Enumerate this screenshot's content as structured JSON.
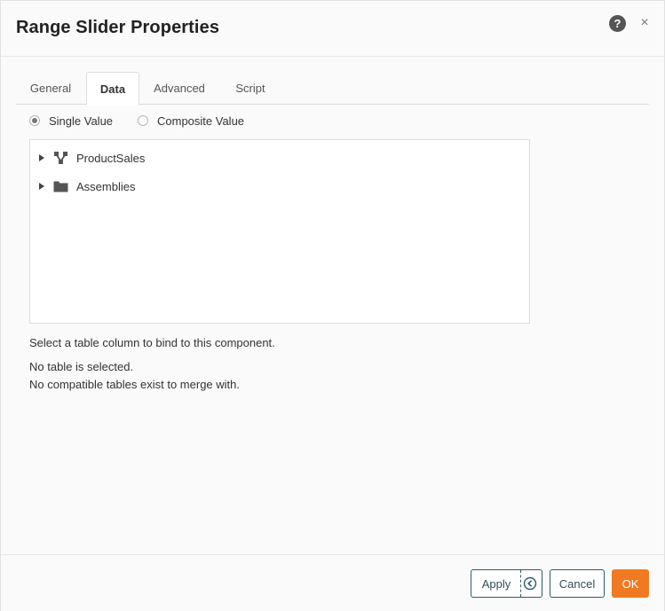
{
  "dialog": {
    "title": "Range Slider Properties",
    "help_icon": "help-icon",
    "help_glyph": "?",
    "close_icon": "close-icon",
    "close_glyph": "×"
  },
  "tabs": [
    {
      "label": "General",
      "active": false
    },
    {
      "label": "Data",
      "active": true
    },
    {
      "label": "Advanced",
      "active": false
    },
    {
      "label": "Script",
      "active": false
    }
  ],
  "value_mode": {
    "options": [
      {
        "label": "Single Value",
        "checked": true
      },
      {
        "label": "Composite Value",
        "checked": false
      }
    ]
  },
  "tree": {
    "items": [
      {
        "label": "ProductSales",
        "icon": "data-model-icon"
      },
      {
        "label": "Assemblies",
        "icon": "folder-icon"
      }
    ]
  },
  "info": {
    "instruction": "Select a table column to bind to this component.",
    "no_table": "No table is selected.",
    "no_merge": "No compatible tables exist to merge with."
  },
  "footer": {
    "apply_label": "Apply",
    "cancel_label": "Cancel",
    "ok_label": "OK"
  },
  "colors": {
    "accent": "#f07a22",
    "button_border": "#2f5a6a"
  }
}
